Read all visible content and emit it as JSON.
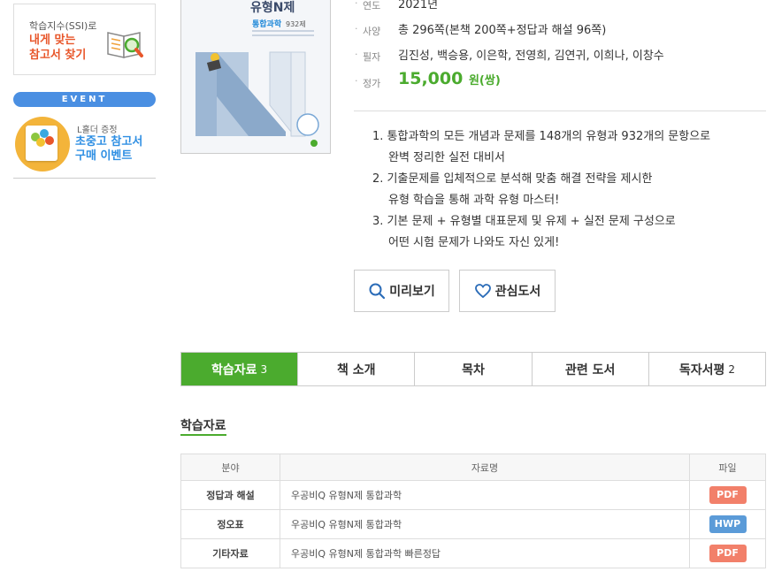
{
  "sidebar": {
    "ssi_banner": {
      "subtitle": "학습지수(SSI)로",
      "title_line1": "내게 맞는",
      "title_line2": "참고서 찾기"
    },
    "event_label": "EVENT",
    "event_banner": {
      "subtitle": "L홀더 증정",
      "title_line1": "초중고 참고서",
      "title_line2": "구매 이벤트"
    }
  },
  "book": {
    "cover_series": "유형N제",
    "cover_subject": "통합과학",
    "cover_count": "932제",
    "year_label": "연도",
    "year": "2021년",
    "spec_label": "사양",
    "spec": "총 296쪽(본책 200쪽+정답과 해설 96쪽)",
    "authors_label": "필자",
    "authors": "김진성, 백승용, 이은학, 전영희, 김연귀, 이희나, 이창수",
    "price_label": "정가",
    "price": "15,000",
    "price_unit": "원(쌍)"
  },
  "features": [
    {
      "line1": "1. 통합과학의 모든 개념과 문제를 148개의 유형과 932개의 문항으로",
      "line2": "완벽 정리한 실전 대비서"
    },
    {
      "line1": "2. 기출문제를 입체적으로 분석해 맞춤 해결 전략을 제시한",
      "line2": "유형 학습을 통해 과학 유형 마스터!"
    },
    {
      "line1": "3. 기본 문제 + 유형별 대표문제 및 유제 + 실전 문제 구성으로",
      "line2": "어떤 시험 문제가 나와도 자신 있게!"
    }
  ],
  "buttons": {
    "preview": "미리보기",
    "wishlist": "관심도서"
  },
  "tabs": [
    {
      "label": "학습자료",
      "count": "3"
    },
    {
      "label": "책 소개",
      "count": ""
    },
    {
      "label": "목차",
      "count": ""
    },
    {
      "label": "관련 도서",
      "count": ""
    },
    {
      "label": "독자서평",
      "count": "2"
    }
  ],
  "materials": {
    "title": "학습자료",
    "headers": {
      "category": "분야",
      "name": "자료명",
      "file": "파일"
    },
    "rows": [
      {
        "category": "정답과 해설",
        "name": "우공비Q 유형N제 통합과학",
        "file": "PDF"
      },
      {
        "category": "정오표",
        "name": "우공비Q 유형N제 통합과학",
        "file": "HWP"
      },
      {
        "category": "기타자료",
        "name": "우공비Q 유형N제 통합과학 빠른정답",
        "file": "PDF"
      }
    ]
  },
  "colors": {
    "accent_green": "#4bab2e",
    "pdf_badge": "#f2806a",
    "hwp_badge": "#5b9bd8",
    "event_blue": "#4a8fe2",
    "ssi_orange": "#e8562a"
  }
}
